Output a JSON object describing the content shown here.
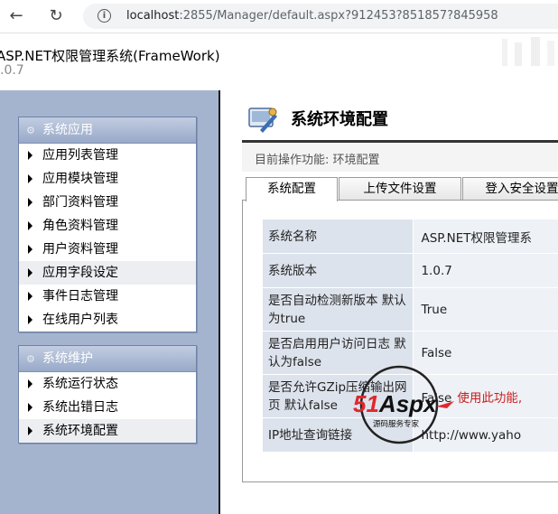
{
  "browser": {
    "url_host": "localhost",
    "url_rest": ":2855/Manager/default.aspx?912453?851857?845958"
  },
  "header": {
    "title": "ASP.NET权限管理系统(FrameWork)",
    "version": ".0.7"
  },
  "sidebar": {
    "groups": [
      {
        "title": "系统应用",
        "items": [
          "应用列表管理",
          "应用模块管理",
          "部门资料管理",
          "角色资料管理",
          "用户资料管理",
          "应用字段设定",
          "事件日志管理",
          "在线用户列表"
        ]
      },
      {
        "title": "系统维护",
        "items": [
          "系统运行状态",
          "系统出错日志",
          "系统环境配置"
        ]
      }
    ]
  },
  "main": {
    "title": "系统环境配置",
    "operation": "目前操作功能: 环境配置",
    "tabs": [
      "系统配置",
      "上传文件设置",
      "登入安全设置"
    ],
    "rows": [
      {
        "label": "系统名称",
        "value": "ASP.NET权限管理系"
      },
      {
        "label": "系统版本",
        "value": "1.0.7"
      },
      {
        "label": "是否自动检测新版本 默认为true",
        "value": "True"
      },
      {
        "label": "是否启用用户访问日志 默认为false",
        "value": "False"
      },
      {
        "label": "是否允许GZip压缩输出网页 默认false",
        "value": "False",
        "note": "使用此功能,"
      },
      {
        "label": "IP地址查询链接",
        "value": "http://www.yaho"
      }
    ]
  },
  "watermark": {
    "brand": "51Aspx",
    "tagline": "源码服务专家"
  }
}
